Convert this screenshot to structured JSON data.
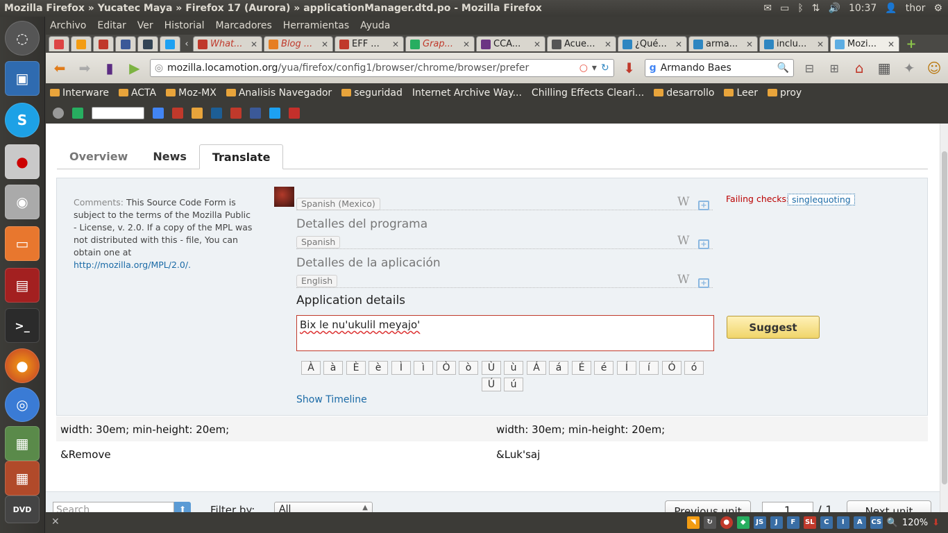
{
  "window": {
    "title": "Mozilla Firefox » Yucatec Maya » Firefox 17 (Aurora) » applicationManager.dtd.po - Mozilla Firefox"
  },
  "panel": {
    "time": "10:37",
    "user": "thor"
  },
  "menu": [
    "Archivo",
    "Editar",
    "Ver",
    "Historial",
    "Marcadores",
    "Herramientas",
    "Ayuda"
  ],
  "tabs": [
    {
      "label": "What...",
      "color": "#c0392b"
    },
    {
      "label": "Blog ...",
      "color": "#e67e22"
    },
    {
      "label": "EFF ...",
      "color": "#c0392b"
    },
    {
      "label": "Grap...",
      "color": "#27ae60"
    },
    {
      "label": "CCA...",
      "color": "#6c3483"
    },
    {
      "label": "Acue...",
      "color": "#555555"
    },
    {
      "label": "¿Qué...",
      "color": "#2e86c1"
    },
    {
      "label": "arma...",
      "color": "#2e86c1"
    },
    {
      "label": "inclu...",
      "color": "#2e86c1"
    },
    {
      "label": "Mozi...",
      "color": "#5dade2"
    }
  ],
  "url": {
    "host": "mozilla.locamotion.org",
    "path": "/yua/firefox/config1/browser/chrome/browser/prefer"
  },
  "search": {
    "value": "Armando Baes"
  },
  "bookmarks": [
    {
      "label": "Interware",
      "folder": true
    },
    {
      "label": "ACTA",
      "folder": true
    },
    {
      "label": "Moz-MX",
      "folder": true
    },
    {
      "label": "Analisis Navegador",
      "folder": true
    },
    {
      "label": "seguridad",
      "folder": true
    },
    {
      "label": "Internet Archive Way...",
      "folder": false
    },
    {
      "label": "Chilling Effects Cleari...",
      "folder": false
    },
    {
      "label": "desarrollo",
      "folder": true
    },
    {
      "label": "Leer",
      "folder": true
    },
    {
      "label": "proy",
      "folder": true
    }
  ],
  "page_tabs": {
    "overview": "Overview",
    "news": "News",
    "translate": "Translate"
  },
  "unit": {
    "comments_label": "Comments:",
    "comments_text": "This Source Code Form is subject to the terms of the Mozilla Public - License, v. 2.0. If a copy of the MPL was not distributed with this - file, You can obtain one at",
    "comments_link": "http://mozilla.org/MPL/2.0/.",
    "alt_sources": [
      {
        "lang": "Spanish (Mexico)",
        "text": "Detalles del programa"
      },
      {
        "lang": "Spanish",
        "text": "Detalles de la aplicación"
      },
      {
        "lang": "English",
        "text": ""
      }
    ],
    "source_text": "Application details",
    "translation": "Bix le nu'ukulil meyajo'",
    "suggest_label": "Suggest",
    "failing_label": "Failing checks:",
    "failing_check": "singlequoting",
    "wiki_icon": "W",
    "special_chars": [
      "À",
      "à",
      "È",
      "è",
      "Ì",
      "ì",
      "Ò",
      "ò",
      "Ù",
      "ù",
      "Á",
      "á",
      "É",
      "é",
      "Í",
      "í",
      "Ó",
      "ó",
      "Ú",
      "ú"
    ],
    "show_timeline": "Show Timeline"
  },
  "context_rows": [
    {
      "source": "width: 30em; min-height: 20em;",
      "target": "width: 30em; min-height: 20em;"
    },
    {
      "source": "&Remove",
      "target": "&Luk'saj"
    }
  ],
  "footer": {
    "search_placeholder": "Search",
    "filter_label": "Filter by:",
    "filter_value": "All",
    "prev_label": "Previous unit",
    "page_value": "1",
    "page_total": "/ 1",
    "next_label": "Next unit"
  },
  "statusbar": {
    "zoom": "120%"
  }
}
